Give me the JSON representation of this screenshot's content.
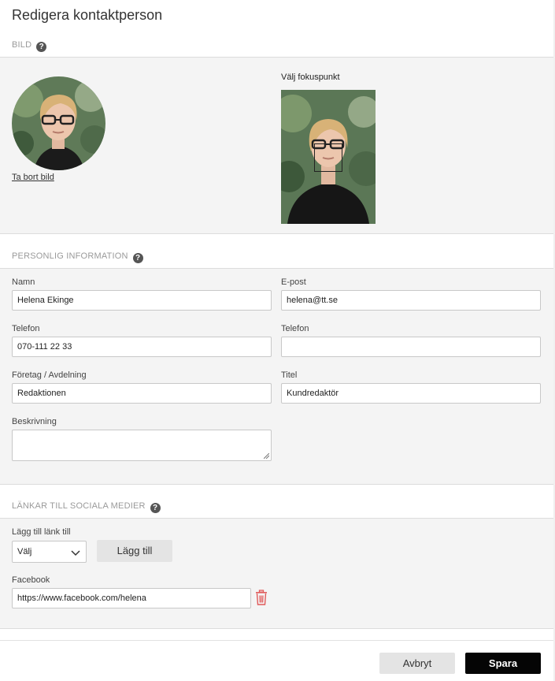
{
  "dialog": {
    "title": "Redigera kontaktperson"
  },
  "image_section": {
    "header": "BILD",
    "remove_link": "Ta bort bild",
    "focus_label": "Välj fokuspunkt"
  },
  "personal_section": {
    "header": "PERSONLIG INFORMATION",
    "fields": {
      "name": {
        "label": "Namn",
        "value": "Helena Ekinge"
      },
      "email": {
        "label": "E-post",
        "value": "helena@tt.se"
      },
      "phone1": {
        "label": "Telefon",
        "value": "070-111 22 33"
      },
      "phone2": {
        "label": "Telefon",
        "value": ""
      },
      "company": {
        "label": "Företag / Avdelning",
        "value": "Redaktionen"
      },
      "title": {
        "label": "Titel",
        "value": "Kundredaktör"
      },
      "description": {
        "label": "Beskrivning",
        "value": ""
      }
    }
  },
  "social_section": {
    "header": "LÄNKAR TILL SOCIALA MEDIER",
    "add_label": "Lägg till länk till",
    "select_value": "Välj",
    "add_button": "Lägg till",
    "facebook": {
      "label": "Facebook",
      "value": "https://www.facebook.com/helena"
    }
  },
  "footer": {
    "cancel": "Avbryt",
    "save": "Spara"
  },
  "colors": {
    "accent_save": "#050505",
    "trash": "#e05a5a",
    "panel_bg": "#f4f4f4"
  },
  "icons": {
    "help": "help-circle-icon",
    "trash": "trash-icon",
    "chevron": "chevron-down-icon"
  }
}
